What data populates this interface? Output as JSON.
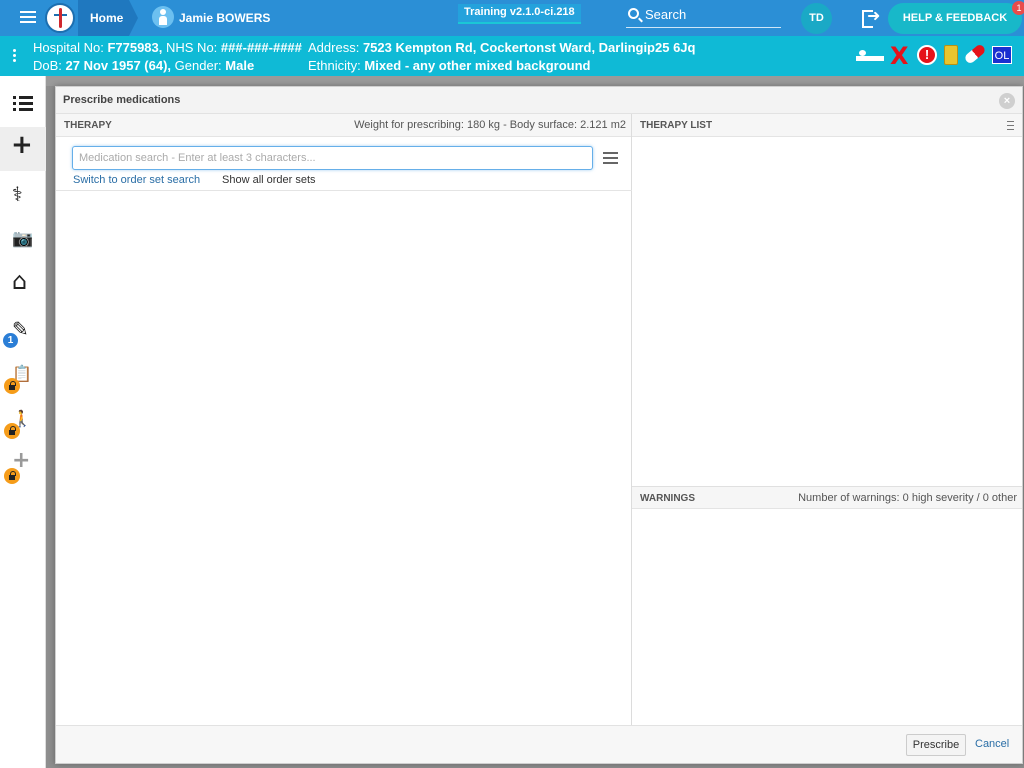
{
  "topbar": {
    "home_label": "Home",
    "patient_name": "Jamie BOWERS",
    "env_label": "Training v2.1.0-ci.218",
    "search_label": "Search",
    "avatar_initials": "TD",
    "help_label": "HELP & FEEDBACK",
    "help_badge_count": "1"
  },
  "banner": {
    "hospital_label": "Hospital No:",
    "hospital_no": "F775983,",
    "nhs_label": "NHS No:",
    "nhs_no": "###-###-####",
    "address_label": "Address:",
    "address": "7523 Kempton Rd, Cockertonst Ward, Darlingip25 6Jq",
    "dob_label": "DoB:",
    "dob": "27 Nov 1957 (64),",
    "gender_label": "Gender:",
    "gender": "Male",
    "ethnicity_label": "Ethnicity:",
    "ethnicity": "Mixed - any other mixed background",
    "alert_symbol": "!",
    "x_symbol": "X",
    "ol_label": "OL",
    "colors": {
      "alert_red": "#e5131a",
      "banner_bg": "#0fbad6"
    }
  },
  "sidebar": {
    "items": [
      {
        "icon": "list-icon"
      },
      {
        "icon": "plus-icon",
        "glyph": "+"
      },
      {
        "icon": "stethoscope-icon",
        "glyph": "⚕"
      },
      {
        "icon": "camera-icon",
        "glyph": "📷"
      },
      {
        "icon": "home-plus-icon",
        "glyph": "⌂"
      },
      {
        "icon": "document-edit-icon",
        "glyph": "✎",
        "badge": "1"
      },
      {
        "icon": "clipboard-lock-icon",
        "glyph": "📋"
      },
      {
        "icon": "person-walk-lock-icon",
        "glyph": "🚶"
      },
      {
        "icon": "plus-lock-icon",
        "glyph": "+"
      }
    ]
  },
  "modal": {
    "title": "Prescribe medications",
    "close_symbol": "×",
    "therapy": {
      "label": "THERAPY",
      "weight_info": "Weight for prescribing: 180 kg - Body surface: 2.121 m2",
      "search_placeholder": "Medication search - Enter at least 3 characters...",
      "search_value": "",
      "switch_link": "Switch to order set search",
      "show_all_link": "Show all order sets"
    },
    "therapy_list": {
      "label": "THERAPY LIST"
    },
    "warnings": {
      "label": "WARNINGS",
      "summary": "Number of warnings: 0 high severity / 0 other"
    },
    "footer": {
      "prescribe_label": "Prescribe",
      "cancel_label": "Cancel"
    }
  }
}
